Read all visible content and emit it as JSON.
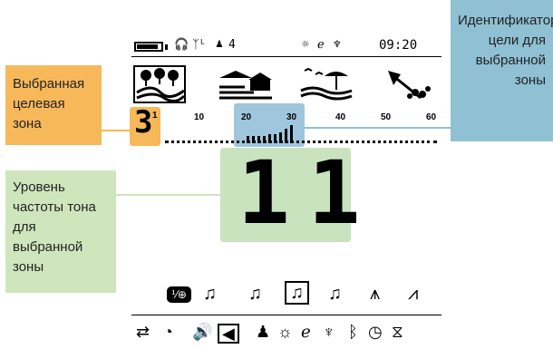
{
  "callouts": {
    "zone": "Выбранная целевая зона",
    "ids": "Идентификаторы цели для выбранной зоны",
    "tone": "Уровень частоты тона для выбранной зоны"
  },
  "status": {
    "antenna": "ᛉᴸ",
    "level": "4",
    "time": "09:20",
    "battery_level": 0.9
  },
  "zone": {
    "number": "3",
    "superscript": "1",
    "scale": [
      "10",
      "20",
      "30",
      "40",
      "50",
      "60"
    ]
  },
  "tone_display": "11",
  "tone_icons": [
    "fe-toggle",
    "multi-tone",
    "tone-volume",
    "tone-break",
    "tone-reverse",
    "wave",
    "wave-cross"
  ],
  "bottom_icons": [
    "ground-balance",
    "sensitivity",
    "volume",
    "tone-volume",
    "user",
    "brightness",
    "frequency",
    "lamp",
    "bluetooth",
    "clock",
    "timer"
  ]
}
